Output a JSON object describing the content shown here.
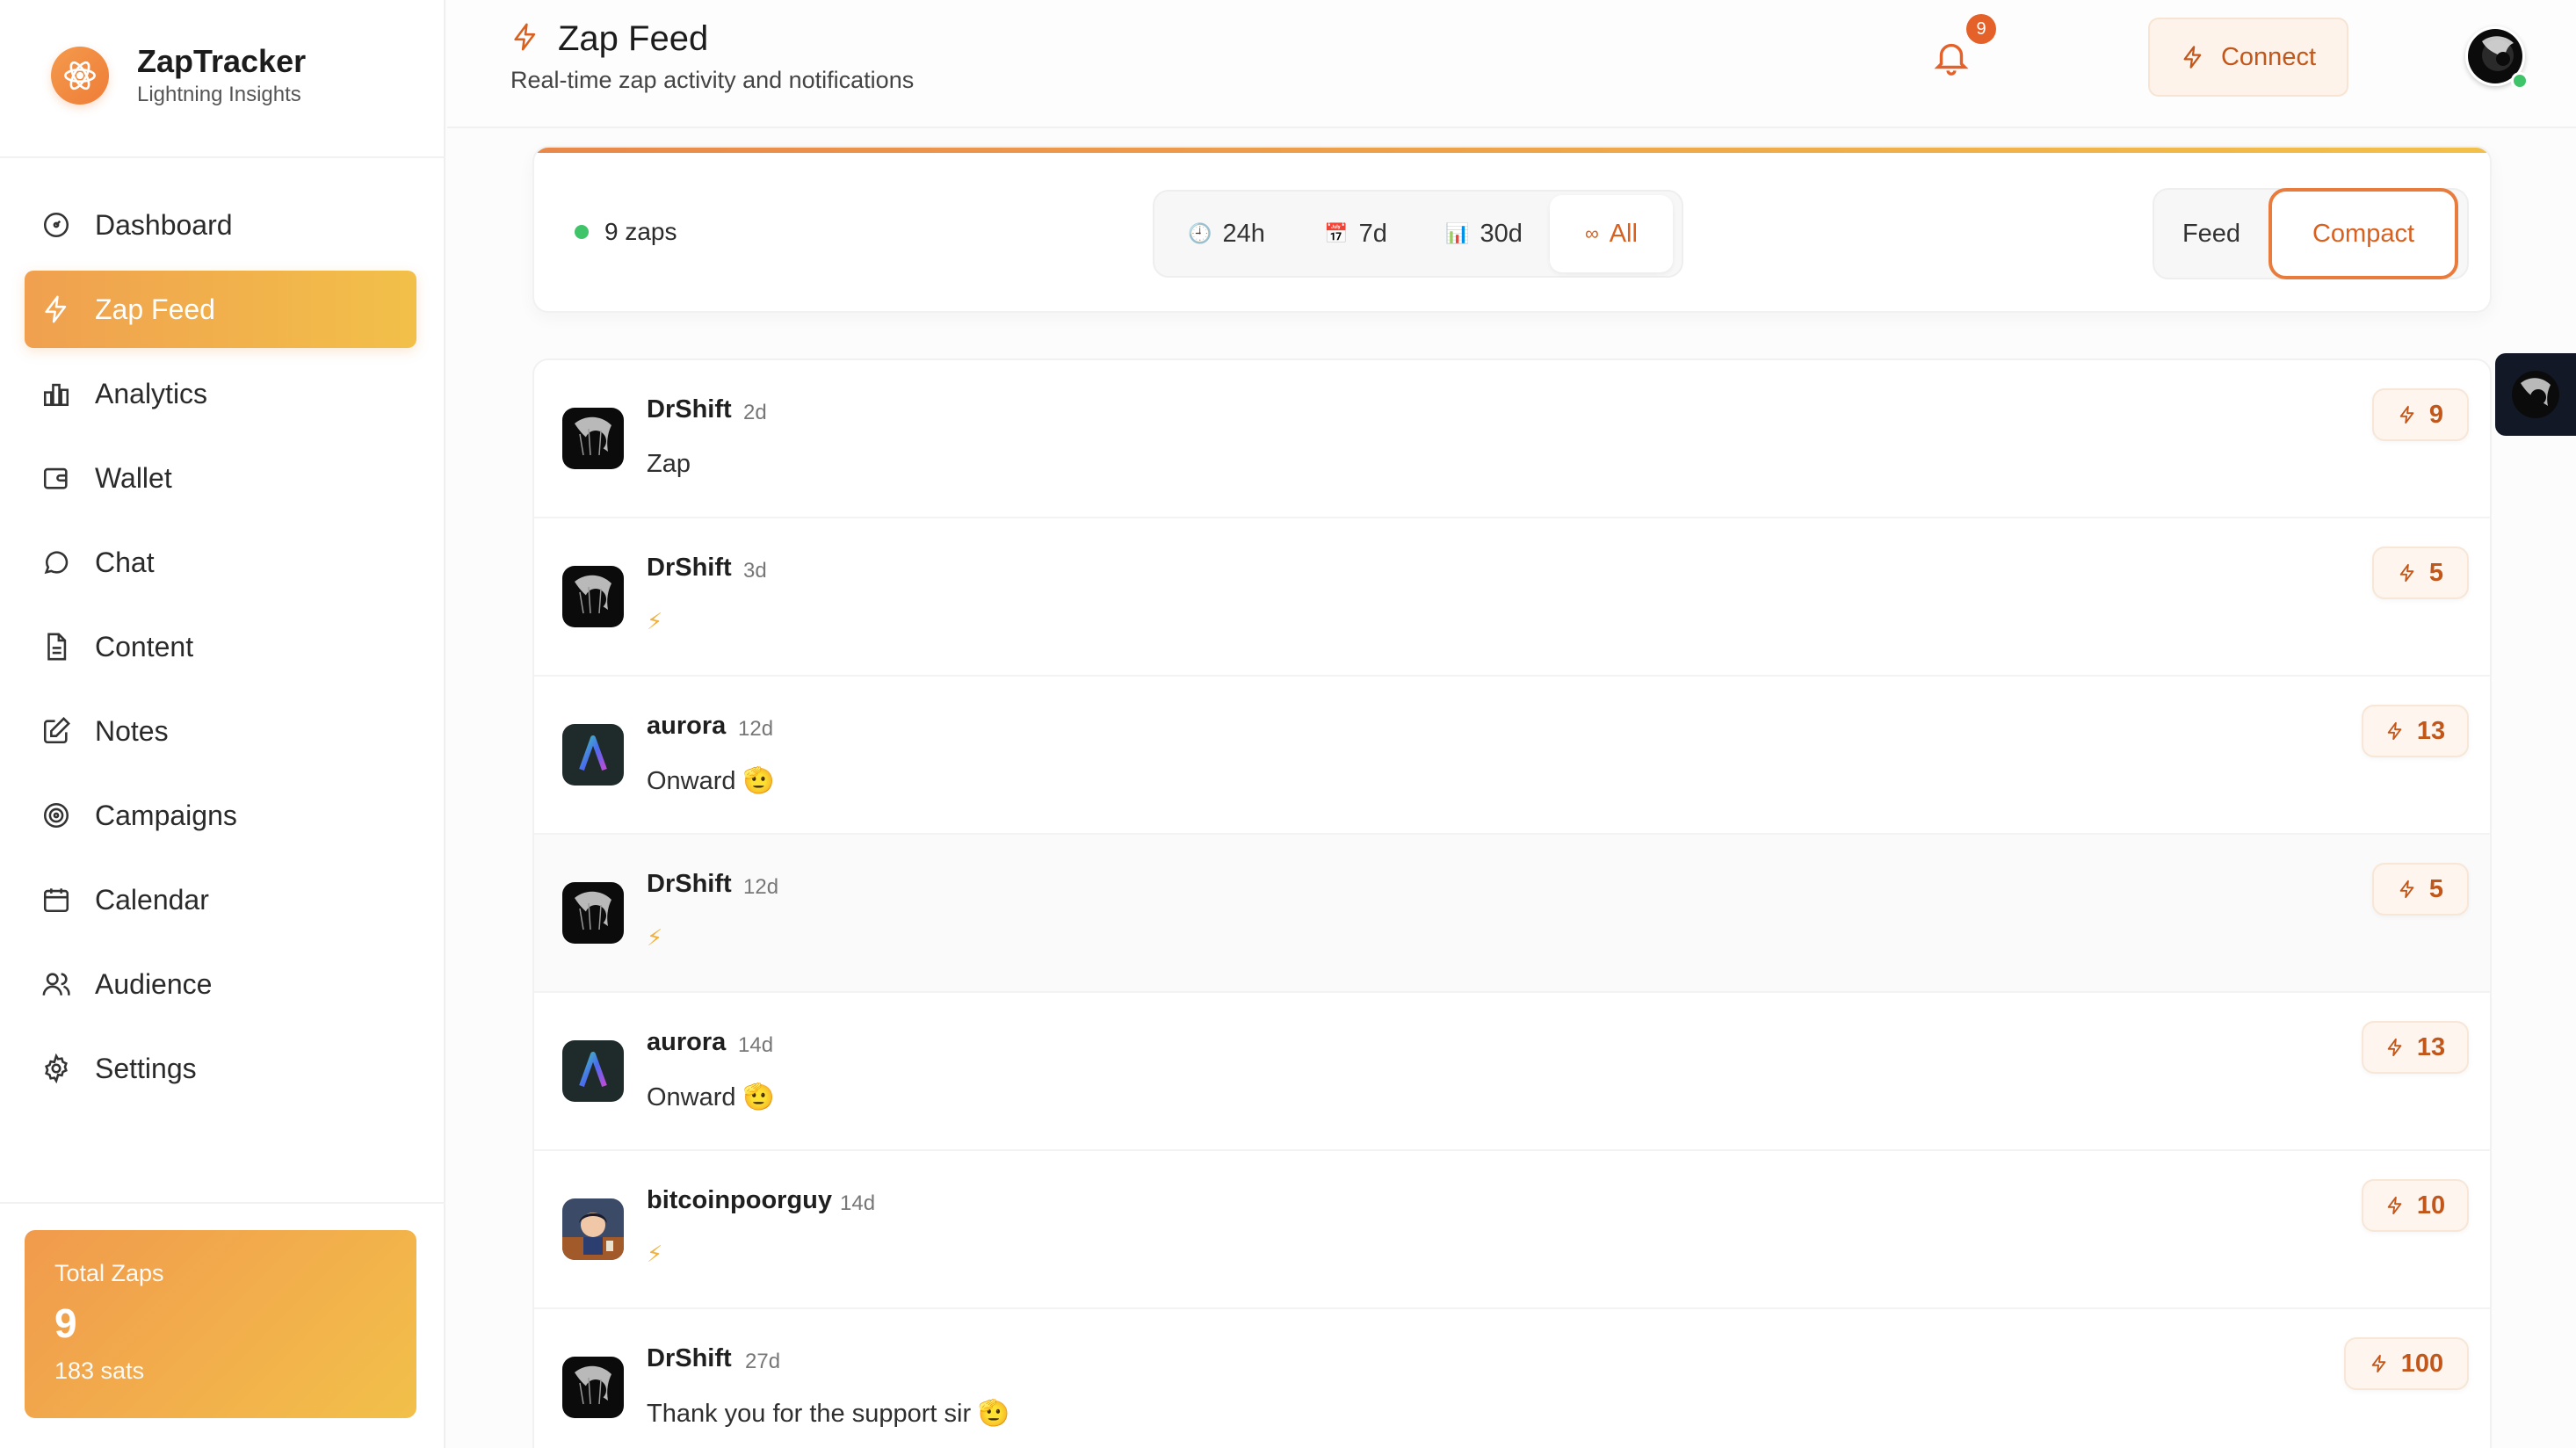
{
  "brand": {
    "name": "ZapTracker",
    "subtitle": "Lightning Insights",
    "logo_icon": "atom-icon"
  },
  "sidebar": {
    "items": [
      {
        "label": "Dashboard",
        "icon": "gauge-icon",
        "active": false
      },
      {
        "label": "Zap Feed",
        "icon": "lightning-icon",
        "active": true
      },
      {
        "label": "Analytics",
        "icon": "bar-chart-icon",
        "active": false
      },
      {
        "label": "Wallet",
        "icon": "wallet-icon",
        "active": false
      },
      {
        "label": "Chat",
        "icon": "chat-bubble-icon",
        "active": false
      },
      {
        "label": "Content",
        "icon": "document-icon",
        "active": false
      },
      {
        "label": "Notes",
        "icon": "pencil-square-icon",
        "active": false
      },
      {
        "label": "Campaigns",
        "icon": "target-icon",
        "active": false
      },
      {
        "label": "Calendar",
        "icon": "calendar-icon",
        "active": false
      },
      {
        "label": "Audience",
        "icon": "users-icon",
        "active": false
      },
      {
        "label": "Settings",
        "icon": "gear-icon",
        "active": false
      }
    ],
    "total_card": {
      "label": "Total Zaps",
      "value": "9",
      "sats": "183 sats"
    }
  },
  "header": {
    "title": "Zap Feed",
    "subtitle": "Real-time zap activity and notifications",
    "connect_label": "Connect",
    "notification_count": "9"
  },
  "filters": {
    "zap_count": "9 zaps",
    "ranges": [
      {
        "icon": "🕘",
        "label": "24h"
      },
      {
        "icon": "📅",
        "label": "7d"
      },
      {
        "icon": "📊",
        "label": "30d"
      },
      {
        "icon": "∞",
        "label": "All"
      }
    ],
    "active_range": "All",
    "views": [
      "Feed",
      "Compact"
    ],
    "active_view": "Compact"
  },
  "zaps": [
    {
      "name": "DrShift",
      "time": "2d",
      "message": "Zap",
      "amount": "9",
      "avatar": "drshift"
    },
    {
      "name": "DrShift",
      "time": "3d",
      "message": "⚡",
      "amount": "5",
      "avatar": "drshift"
    },
    {
      "name": "aurora",
      "time": "12d",
      "message": "Onward 🫡",
      "amount": "13",
      "avatar": "aurora"
    },
    {
      "name": "DrShift",
      "time": "12d",
      "message": "⚡",
      "amount": "5",
      "avatar": "drshift"
    },
    {
      "name": "aurora",
      "time": "14d",
      "message": "Onward 🫡",
      "amount": "13",
      "avatar": "aurora"
    },
    {
      "name": "bitcoinpoorguy",
      "time": "14d",
      "message": "⚡",
      "amount": "10",
      "avatar": "bitcoinpoorguy"
    },
    {
      "name": "DrShift",
      "time": "27d",
      "message": "Thank you for the support sir 🫡",
      "amount": "100",
      "avatar": "drshift"
    }
  ],
  "colors": {
    "accent": "#e97c3c",
    "accent_text": "#c2571b",
    "gradient_start": "#f0a04f",
    "gradient_end": "#f2c049",
    "online": "#3fc46a"
  }
}
